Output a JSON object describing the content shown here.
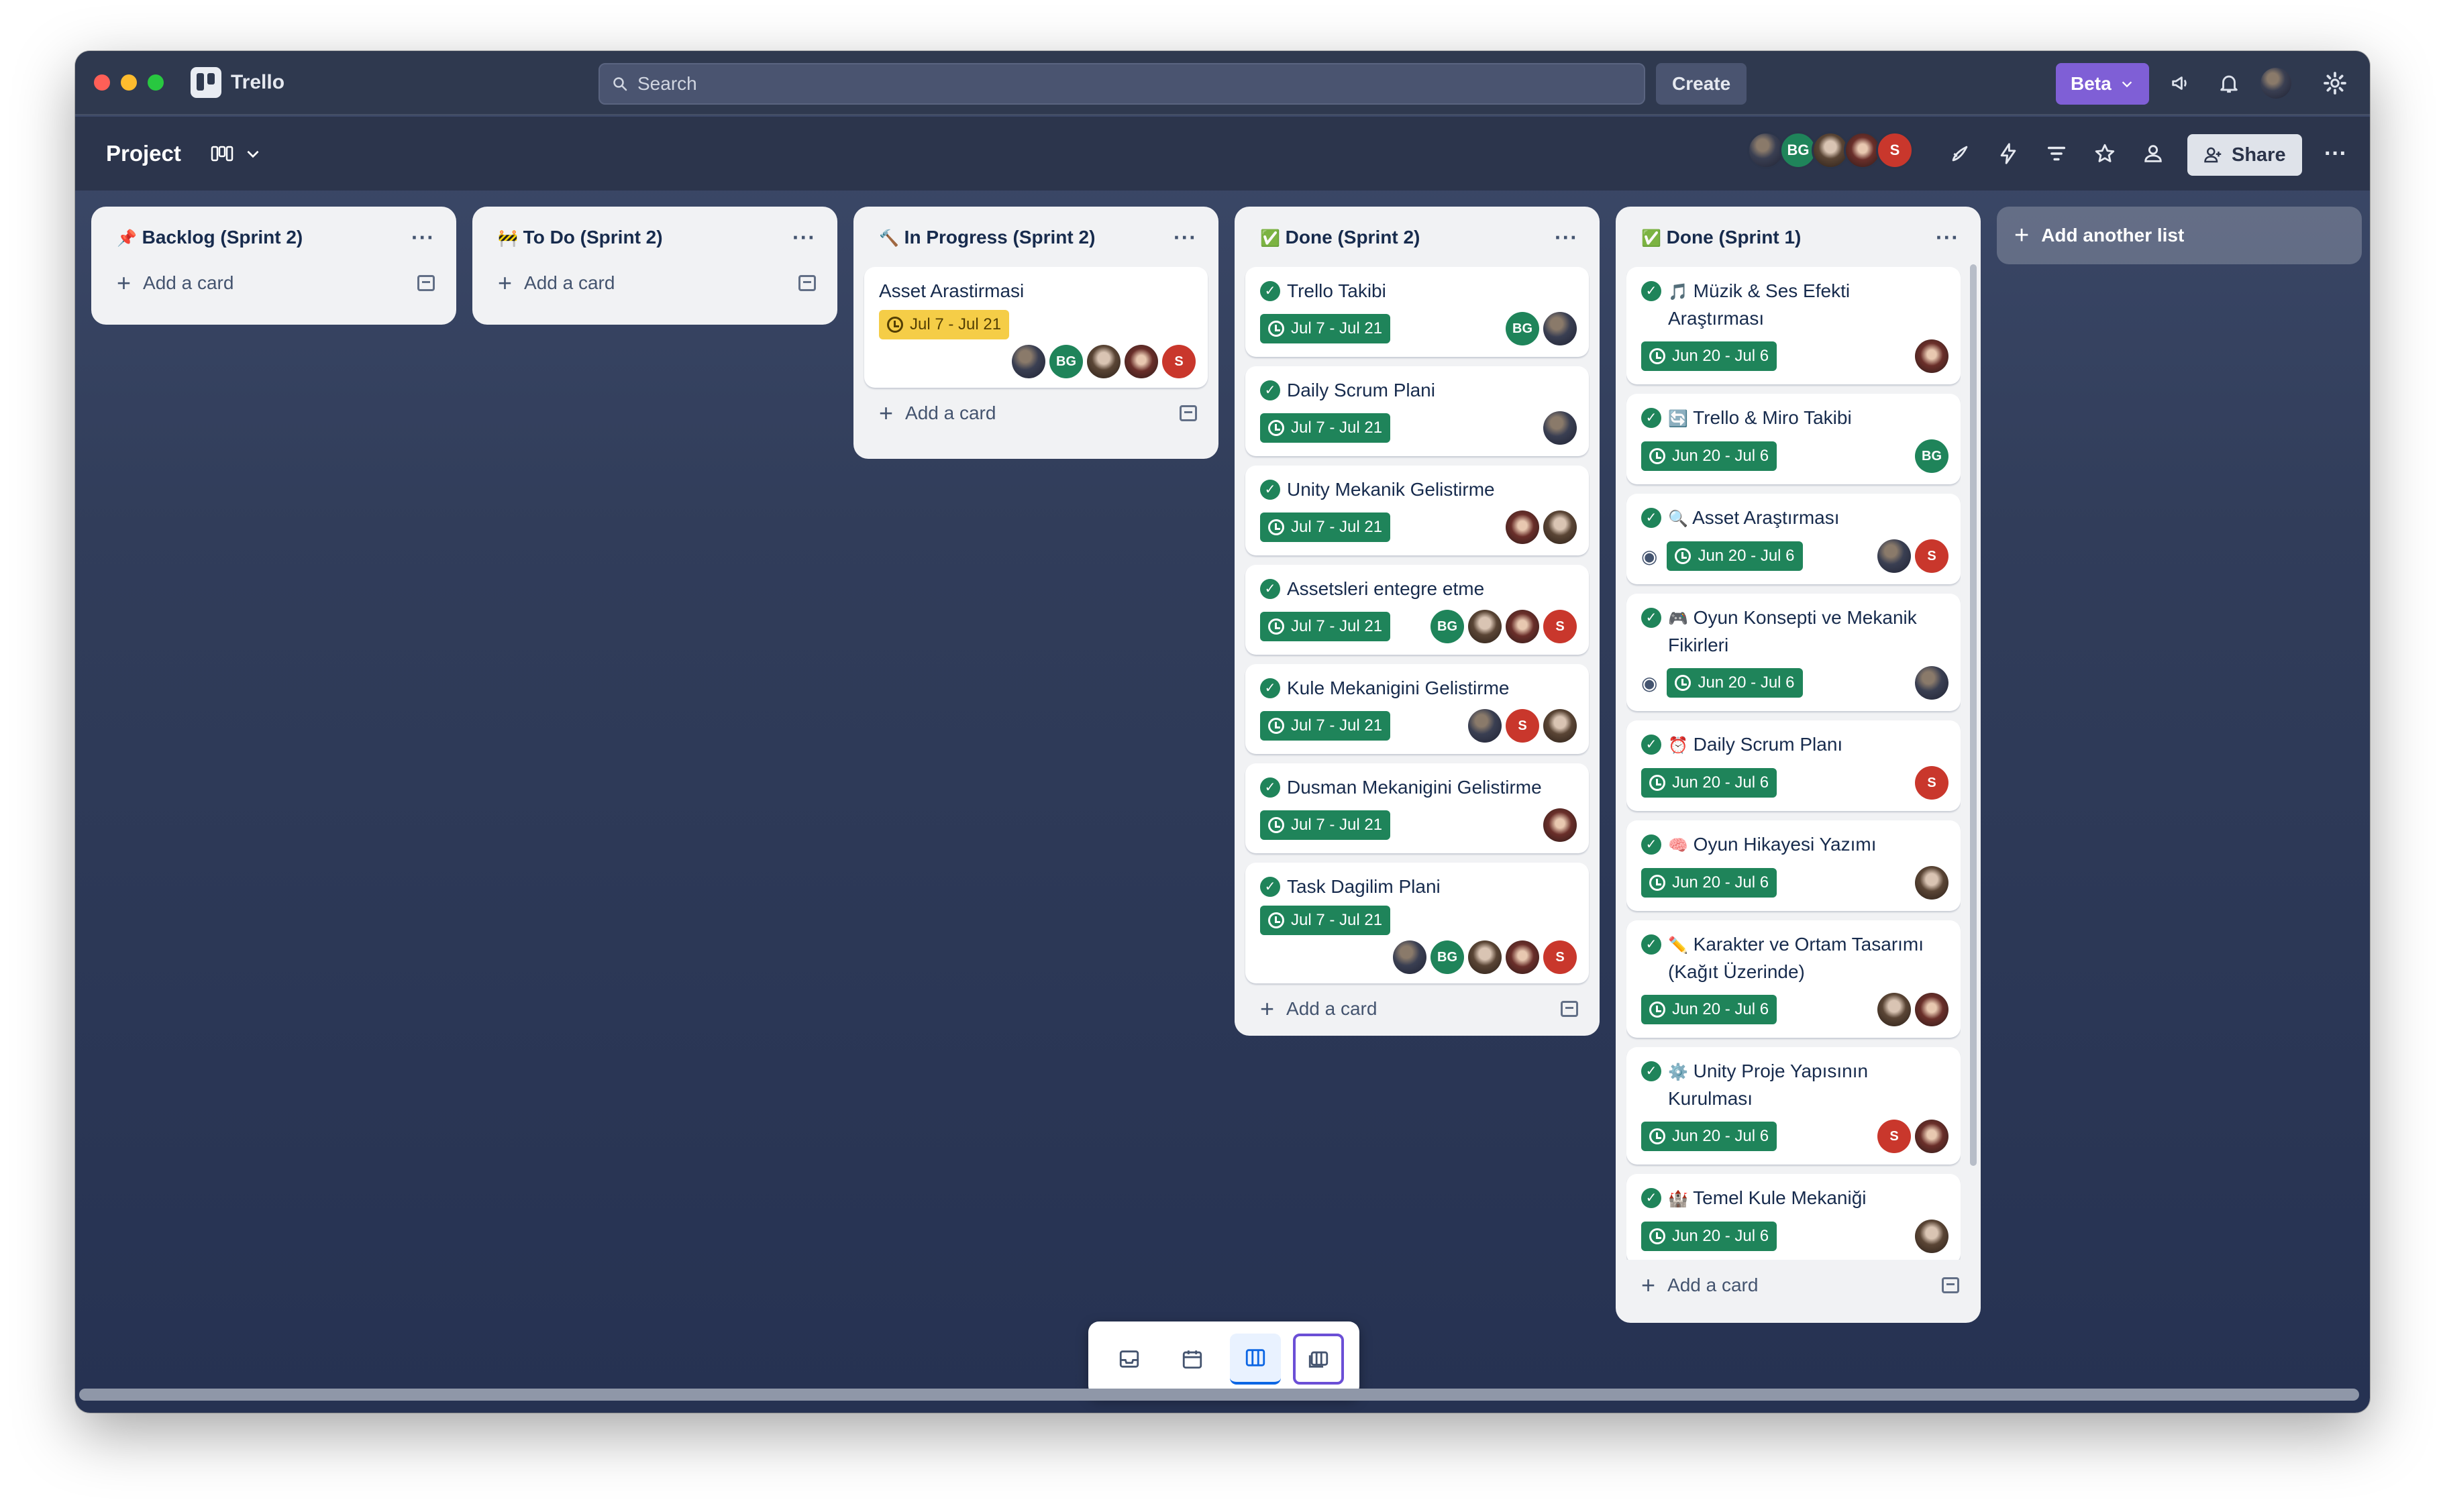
{
  "app": {
    "name": "Trello",
    "search_placeholder": "Search",
    "create_label": "Create",
    "beta_label": "Beta"
  },
  "board": {
    "title": "Project",
    "share_label": "Share",
    "add_list_label": "Add another list",
    "add_card_label": "Add a card",
    "members": [
      "",
      "BG",
      "",
      "",
      "S"
    ]
  },
  "lists": {
    "backlog": {
      "emoji": "📌",
      "title": "Backlog (Sprint 2)"
    },
    "todo": {
      "emoji": "🚧",
      "title": "To Do (Sprint 2)"
    },
    "inprogress": {
      "emoji": "🔨",
      "title": "In Progress (Sprint 2)",
      "cards": [
        {
          "title": "Asset Arastirmasi",
          "date": "Jul 7 - Jul 21"
        }
      ]
    },
    "done2": {
      "emoji": "✅",
      "title": "Done (Sprint 2)",
      "cards": [
        {
          "title": "Trello Takibi",
          "date": "Jul 7 - Jul 21"
        },
        {
          "title": "Daily Scrum Plani",
          "date": "Jul 7 - Jul 21"
        },
        {
          "title": "Unity Mekanik Gelistirme",
          "date": "Jul 7 - Jul 21"
        },
        {
          "title": "Assetsleri entegre etme",
          "date": "Jul 7 - Jul 21"
        },
        {
          "title": "Kule Mekanigini Gelistirme",
          "date": "Jul 7 - Jul 21"
        },
        {
          "title": "Dusman Mekanigini Gelistirme",
          "date": "Jul 7 - Jul 21"
        },
        {
          "title": "Task Dagilim Plani",
          "date": "Jul 7 - Jul 21"
        }
      ]
    },
    "done1": {
      "emoji": "✅",
      "title": "Done (Sprint 1)",
      "cards": [
        {
          "emoji": "🎵",
          "title": "Müzik & Ses Efekti Araştırması",
          "date": "Jun 20 - Jul 6"
        },
        {
          "emoji": "🔄",
          "title": "Trello & Miro Takibi",
          "date": "Jun 20 - Jul 6"
        },
        {
          "emoji": "🔍",
          "title": "Asset Araştırması",
          "date": "Jun 20 - Jul 6"
        },
        {
          "emoji": "🎮",
          "title": "Oyun Konsepti ve Mekanik Fikirleri",
          "date": "Jun 20 - Jul 6"
        },
        {
          "emoji": "⏰",
          "title": "Daily Scrum Planı",
          "date": "Jun 20 - Jul 6"
        },
        {
          "emoji": "🧠",
          "title": "Oyun Hikayesi Yazımı",
          "date": "Jun 20 - Jul 6"
        },
        {
          "emoji": "✏️",
          "title": "Karakter ve Ortam Tasarımı (Kağıt Üzerinde)",
          "date": "Jun 20 - Jul 6"
        },
        {
          "emoji": "⚙️",
          "title": "Unity Proje Yapısının Kurulması",
          "date": "Jun 20 - Jul 6"
        },
        {
          "emoji": "🏰",
          "title": "Temel Kule Mekaniği",
          "date": "Jun 20 - Jul 6"
        }
      ]
    }
  },
  "member_initials": {
    "bg": "BG",
    "s": "S"
  },
  "colors": {
    "accent": "#1f845a",
    "beta": "#7f5fd6",
    "due": "#f5cd47",
    "avatar_s": "#c9372c"
  },
  "icons": [
    "search-icon",
    "chevron-down-icon",
    "megaphone-icon",
    "bell-icon",
    "gear-icon",
    "rocket-icon",
    "lightning-icon",
    "filter-icon",
    "star-icon",
    "group-icon",
    "add-person-icon",
    "more-icon",
    "inbox-icon",
    "calendar-icon",
    "board-icon",
    "switch-boards-icon"
  ]
}
